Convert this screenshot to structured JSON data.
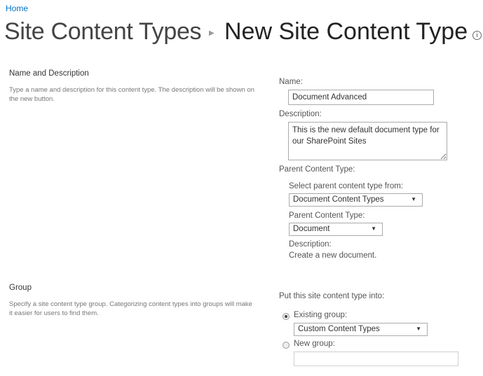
{
  "breadcrumb": {
    "home": "Home"
  },
  "title": {
    "parent": "Site Content Types",
    "separator": "›",
    "current": "New Site Content Type",
    "info_icon": "info-circle-icon"
  },
  "name_section": {
    "heading": "Name and Description",
    "description": "Type a name and description for this content type. The description will be shown on the new button.",
    "name_label": "Name:",
    "name_value": "Document Advanced",
    "description_label": "Description:",
    "description_value": "This is the new default document type for our SharePoint Sites",
    "parent_label": "Parent Content Type:",
    "select_from_label": "Select parent content type from:",
    "select_from_value": "Document Content Types",
    "parent_type_label": "Parent Content Type:",
    "parent_type_value": "Document",
    "parent_desc_label": "Description:",
    "parent_desc_value": "Create a new document."
  },
  "group_section": {
    "heading": "Group",
    "description": "Specify a site content type group. Categorizing content types into groups will make it easier for users to find them.",
    "put_label": "Put this site content type into:",
    "existing_label": "Existing group:",
    "existing_value": "Custom Content Types",
    "new_label": "New group:",
    "new_value": "",
    "selected": "existing"
  }
}
